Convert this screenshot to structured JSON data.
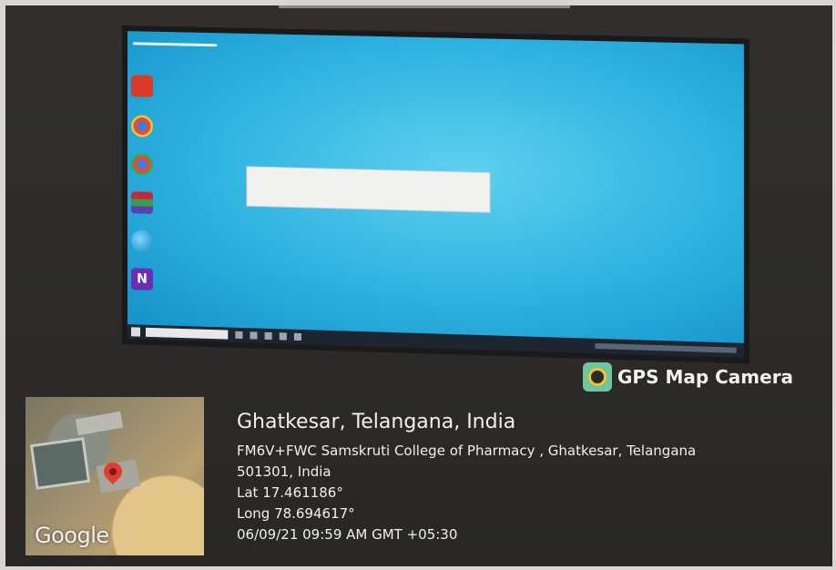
{
  "watermark": {
    "brand_name": "GPS Map Camera",
    "logo_icon": "gps-map-camera-logo-icon",
    "accent_color": "#6ec6a0"
  },
  "map": {
    "provider_logo": "Google",
    "pin_color": "#e23d32"
  },
  "location": {
    "city": "Ghatkesar, Telangana, India",
    "address_line1": "FM6V+FWC Samskruti College of Pharmacy , Ghatkesar, Telangana",
    "address_line2": "501301, India",
    "latitude": "Lat 17.461186°",
    "longitude": "Long 78.694617°",
    "datetime": "06/09/21 09:59 AM GMT +05:30"
  },
  "desktop": {
    "wallpaper_color": "#2eb2e0",
    "icons": [
      "pdf-icon",
      "chrome-icon",
      "chrome-icon",
      "winrar-icon",
      "edge-icon",
      "n-app-icon"
    ]
  }
}
